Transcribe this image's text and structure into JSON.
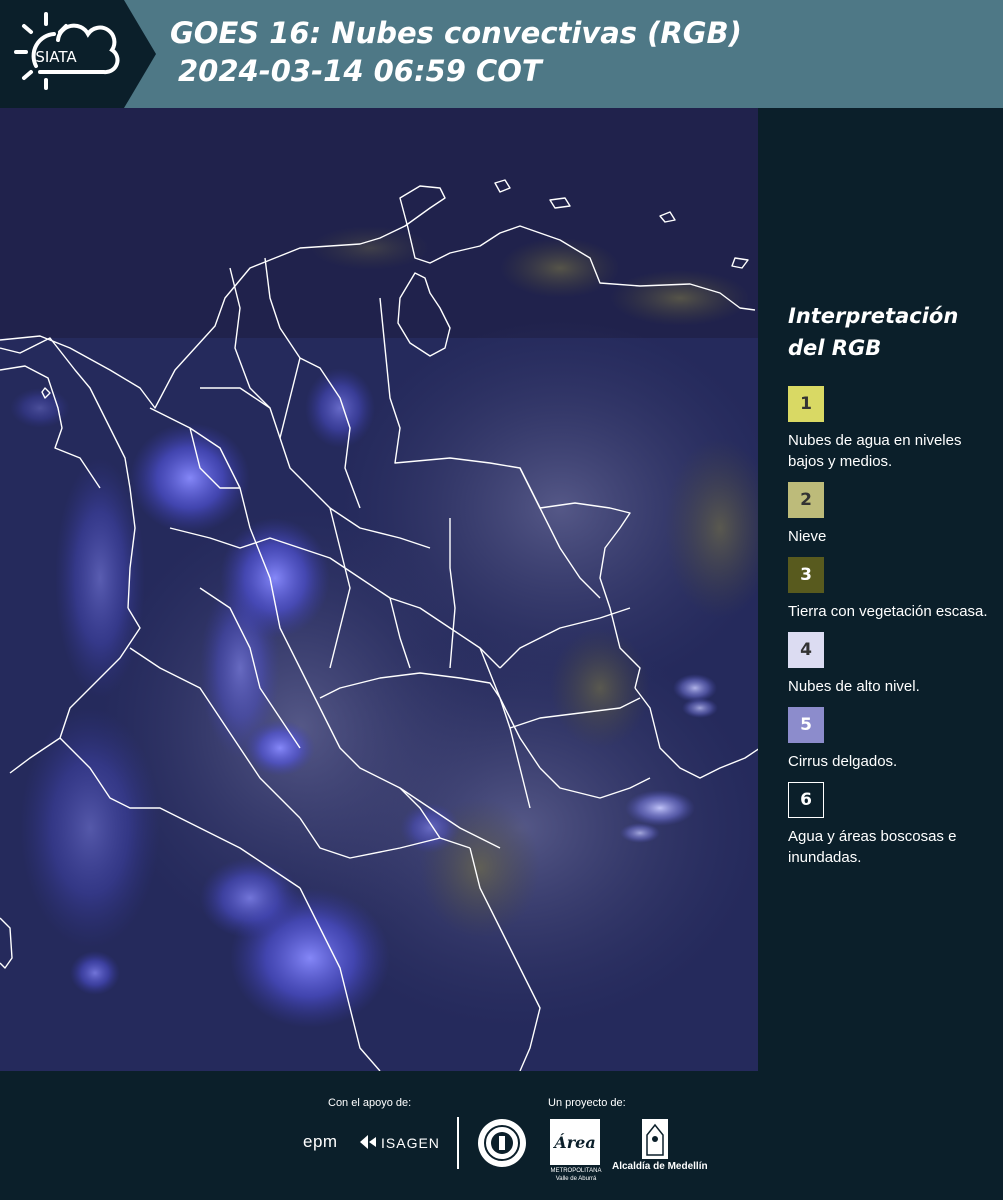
{
  "header": {
    "brand": "SIATA",
    "title_line1": "GOES 16: Nubes convectivas (RGB)",
    "title_line2": "2024-03-14 06:59 COT"
  },
  "legend": {
    "title_line1": "Interpretación",
    "title_line2": "del RGB",
    "items": [
      {
        "number": "1",
        "label": "Nubes de agua en niveles bajos y medios.",
        "color": "#d9d964"
      },
      {
        "number": "2",
        "label": "Nieve",
        "color": "#bdbb7a"
      },
      {
        "number": "3",
        "label": "Tierra con vegetación escasa.",
        "color": "#585a1e"
      },
      {
        "number": "4",
        "label": "Nubes de alto nivel.",
        "color": "#dcdcf2"
      },
      {
        "number": "5",
        "label": "Cirrus delgados.",
        "color": "#8c8ccc"
      },
      {
        "number": "6",
        "label": "Agua y áreas boscosas e inundadas.",
        "color": "#0b1f2a"
      }
    ]
  },
  "footer": {
    "support_label": "Con el apoyo de:",
    "project_label": "Un proyecto de:",
    "sponsor1": "epm",
    "sponsor2": "ISAGEN",
    "partner_area": "Área",
    "partner_area_sub": "METROPOLITANA Valle de Aburrá",
    "partner_medellin": "Alcaldía de Medellín"
  },
  "colors": {
    "header_bg": "#4e7886",
    "page_bg": "#0b1f2a",
    "map_base": "#232757",
    "cloud_blue": "#5a5cf0",
    "boundary": "#ffffff"
  }
}
